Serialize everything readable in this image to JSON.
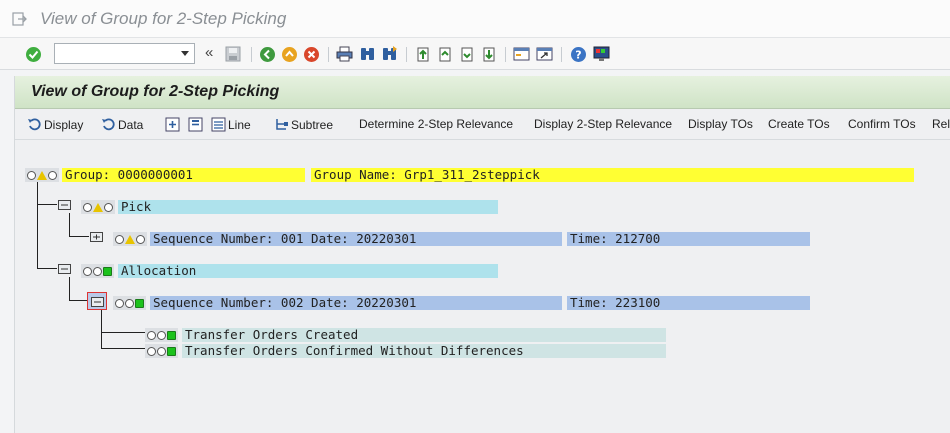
{
  "window": {
    "title": "View of Group for 2-Step Picking"
  },
  "toolbar": {
    "command_value": "",
    "collapse_glyph": "«"
  },
  "panel": {
    "title": "View of Group for 2-Step Picking"
  },
  "app_toolbar": {
    "display": "Display",
    "data": "Data",
    "line": "Line",
    "subtree": "Subtree",
    "determine_relevance": "Determine 2-Step Relevance",
    "display_relevance": "Display 2-Step Relevance",
    "display_tos": "Display TOs",
    "create_tos": "Create TOs",
    "confirm_tos": "Confirm TOs",
    "truncated": "Rel"
  },
  "tree": {
    "group": {
      "id_label": "Group: 0000000001",
      "name_label": "Group Name: Grp1_311_2steppick",
      "status": "yellow-triangle"
    },
    "pick": {
      "label": "Pick",
      "status": "yellow-triangle",
      "item": {
        "seq_date": "Sequence Number: 001 Date: 20220301",
        "time": "Time: 212700",
        "status": "yellow-triangle"
      }
    },
    "allocation": {
      "label": "Allocation",
      "status": "green",
      "item": {
        "seq_date": "Sequence Number: 002 Date: 20220301",
        "time": "Time: 223100",
        "status": "green"
      },
      "children": [
        {
          "label": "Transfer Orders Created",
          "status": "green"
        },
        {
          "label": "Transfer Orders Confirmed Without Differences",
          "status": "green"
        }
      ]
    }
  },
  "colors": {
    "yellow_highlight": "#ffff33",
    "cyan_highlight": "#aee2ec",
    "blue_highlight": "#a9c2e8",
    "teal_highlight": "#cfe4e4",
    "panel_header": "#d6e8ce"
  }
}
